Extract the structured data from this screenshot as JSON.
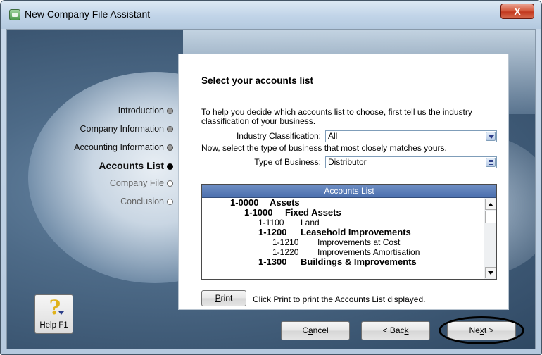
{
  "window": {
    "title": "New Company File Assistant",
    "close_label": "X"
  },
  "steps": [
    {
      "label": "Introduction",
      "state": "done"
    },
    {
      "label": "Company Information",
      "state": "done"
    },
    {
      "label": "Accounting Information",
      "state": "done"
    },
    {
      "label": "Accounts List",
      "state": "current"
    },
    {
      "label": "Company File",
      "state": "future"
    },
    {
      "label": "Conclusion",
      "state": "future"
    }
  ],
  "panel": {
    "heading": "Select your accounts list",
    "intro": "To help you decide which accounts list to choose, first tell us the industry classification of your business.",
    "industry_label": "Industry Classification:",
    "industry_value": "All",
    "type_intro": "Now, select the type of business that most closely matches yours.",
    "business_type_label": "Type of Business:",
    "business_type_value": "Distributor",
    "list_title": "Accounts List",
    "print_hint": "Click Print to print the Accounts List displayed."
  },
  "accounts": [
    {
      "num": "1-0000",
      "name": "Assets",
      "level": 0,
      "bold": true
    },
    {
      "num": "1-1000",
      "name": "Fixed Assets",
      "level": 1,
      "bold": true
    },
    {
      "num": "1-1100",
      "name": "Land",
      "level": 2,
      "bold": false
    },
    {
      "num": "1-1200",
      "name": "Leasehold Improvements",
      "level": 2,
      "bold": true
    },
    {
      "num": "1-1210",
      "name": "Improvements at Cost",
      "level": 3,
      "bold": false
    },
    {
      "num": "1-1220",
      "name": "Improvements Amortisation",
      "level": 3,
      "bold": false
    },
    {
      "num": "1-1300",
      "name": "Buildings & Improvements",
      "level": 2,
      "bold": true
    }
  ],
  "buttons": {
    "print": {
      "pre": "",
      "key": "P",
      "post": "rint"
    },
    "cancel": {
      "pre": "C",
      "key": "a",
      "post": "ncel"
    },
    "back": {
      "pre": "< Bac",
      "key": "k",
      "post": ""
    },
    "next": {
      "pre": "Ne",
      "key": "x",
      "post": "t >"
    },
    "help": "Help F1"
  }
}
